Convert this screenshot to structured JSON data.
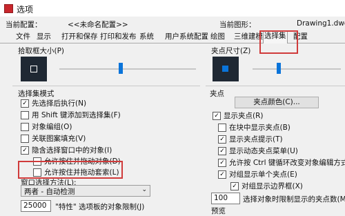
{
  "window": {
    "title": "选项"
  },
  "profile": {
    "current_config_label": "当前配置：",
    "current_config_value": "<<未命名配置>>",
    "current_drawing_label": "当前图形：",
    "current_drawing_value": "Drawing1.dwg"
  },
  "tabs": [
    "文件",
    "显示",
    "打开和保存",
    "打印和发布",
    "系统",
    "用户系统配置",
    "绘图",
    "三维建模",
    "选择集",
    "配置"
  ],
  "left": {
    "pickbox_title": "拾取框大小(P)",
    "pickbox_level": 0.45,
    "selection_modes_title": "选择集模式",
    "modes": [
      {
        "label": "先选择后执行(N)",
        "checked": true
      },
      {
        "label": "用 Shift 键添加到选择集(F)",
        "checked": false
      },
      {
        "label": "对象编组(O)",
        "checked": false
      },
      {
        "label": "关联图案填充(V)",
        "checked": false
      },
      {
        "label": "隐含选择窗口中的对象(I)",
        "checked": true
      },
      {
        "label": "允许按住并拖动对象(D)",
        "checked": false
      },
      {
        "label": "允许按住并拖动套索(L)",
        "checked": false
      }
    ],
    "window_method_label": "窗口选择方法(L):",
    "window_method_value": "两者 - 自动检测",
    "limit_value": "25000",
    "limit_label": "\"特性\" 选项板的对象限制(J)"
  },
  "right": {
    "grip_size_title": "夹点尺寸(Z)",
    "grip_level": 0.3,
    "grips_title": "夹点",
    "grip_color_button": "夹点颜色(C)...",
    "grips": [
      {
        "label": "显示夹点(R)",
        "checked": true
      },
      {
        "label": "在块中显示夹点(B)",
        "checked": false
      },
      {
        "label": "显示夹点提示(T)",
        "checked": true
      },
      {
        "label": "显示动态夹点菜单(U)",
        "checked": true
      },
      {
        "label": "允许按 Ctrl 键循环改变对象编辑方式",
        "checked": true
      },
      {
        "label": "对组显示单个夹点(E)",
        "checked": true
      },
      {
        "label": "对组显示边界框(X)",
        "checked": true
      }
    ],
    "grip_limit_value": "100",
    "grip_limit_label": "选择对象时限制显示的夹点数(M)",
    "preview_title": "预览"
  },
  "colors": {
    "highlight": "#d03a3a",
    "accent": "#0a74da",
    "preview_bg": "#1f2833"
  }
}
